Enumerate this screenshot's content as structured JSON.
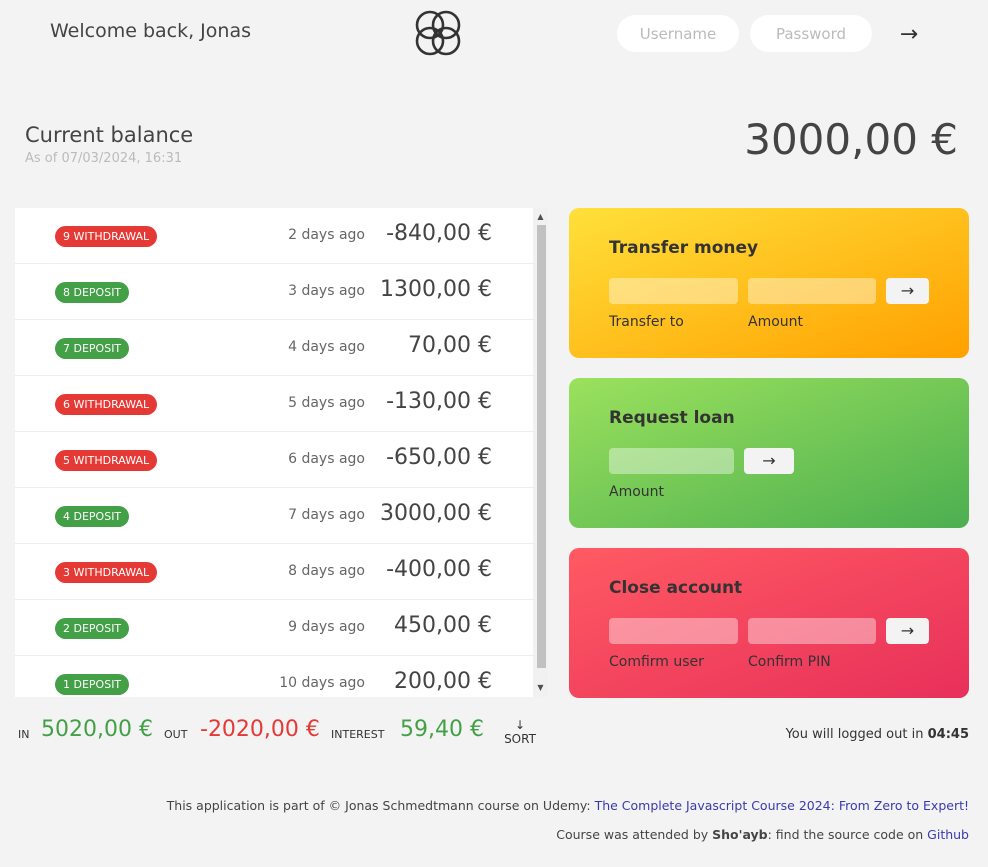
{
  "nav": {
    "welcome": "Welcome back, Jonas",
    "username_placeholder": "Username",
    "pin_placeholder": "Password",
    "login_arrow": "→"
  },
  "balance": {
    "label": "Current balance",
    "date": "As of 07/03/2024, 16:31",
    "value": "3000,00 €"
  },
  "movements": [
    {
      "type": "9 WITHDRAWAL",
      "kind": "withdrawal",
      "date": "2 days ago",
      "value": "-840,00 €"
    },
    {
      "type": "8 DEPOSIT",
      "kind": "deposit",
      "date": "3 days ago",
      "value": "1300,00 €"
    },
    {
      "type": "7 DEPOSIT",
      "kind": "deposit",
      "date": "4 days ago",
      "value": "70,00 €"
    },
    {
      "type": "6 WITHDRAWAL",
      "kind": "withdrawal",
      "date": "5 days ago",
      "value": "-130,00 €"
    },
    {
      "type": "5 WITHDRAWAL",
      "kind": "withdrawal",
      "date": "6 days ago",
      "value": "-650,00 €"
    },
    {
      "type": "4 DEPOSIT",
      "kind": "deposit",
      "date": "7 days ago",
      "value": "3000,00 €"
    },
    {
      "type": "3 WITHDRAWAL",
      "kind": "withdrawal",
      "date": "8 days ago",
      "value": "-400,00 €"
    },
    {
      "type": "2 DEPOSIT",
      "kind": "deposit",
      "date": "9 days ago",
      "value": "450,00 €"
    },
    {
      "type": "1 DEPOSIT",
      "kind": "deposit",
      "date": "10 days ago",
      "value": "200,00 €"
    }
  ],
  "operations": {
    "transfer": {
      "title": "Transfer money",
      "label_to": "Transfer to",
      "label_amount": "Amount",
      "button": "→"
    },
    "loan": {
      "title": "Request loan",
      "label_amount": "Amount",
      "button": "→"
    },
    "close": {
      "title": "Close account",
      "label_user": "Comfirm user",
      "label_pin": "Confirm PIN",
      "button": "→"
    }
  },
  "summary": {
    "in_label": "In",
    "in_value": "5020,00 €",
    "out_label": "Out",
    "out_value": "-2020,00 €",
    "interest_label": "Interest",
    "interest_value": "59,40 €",
    "sort_arrow": "↓",
    "sort_label": "SORT"
  },
  "logout": {
    "text": "You will logged out in",
    "timer": "04:45"
  },
  "footer": {
    "line1_text": "This application is part of © Jonas Schmedtmann course on Udemy: ",
    "line1_link": "The Complete Javascript Course 2024: From Zero to Expert!",
    "line2_text_a": "Course was attended by ",
    "line2_name": "Sho'ayb",
    "line2_text_b": ": find the source code on ",
    "line2_link": "Github"
  },
  "colors": {
    "deposit": "#43a047",
    "withdrawal": "#e53935",
    "transfer_gradient": [
      "#ffe03a",
      "#ffa000"
    ],
    "loan_gradient": [
      "#9be15d",
      "#4caf50"
    ],
    "close_gradient": [
      "#ff5a63",
      "#e8305a"
    ]
  },
  "icons": {
    "logo": "logo-icon",
    "login": "arrow-right-icon"
  }
}
